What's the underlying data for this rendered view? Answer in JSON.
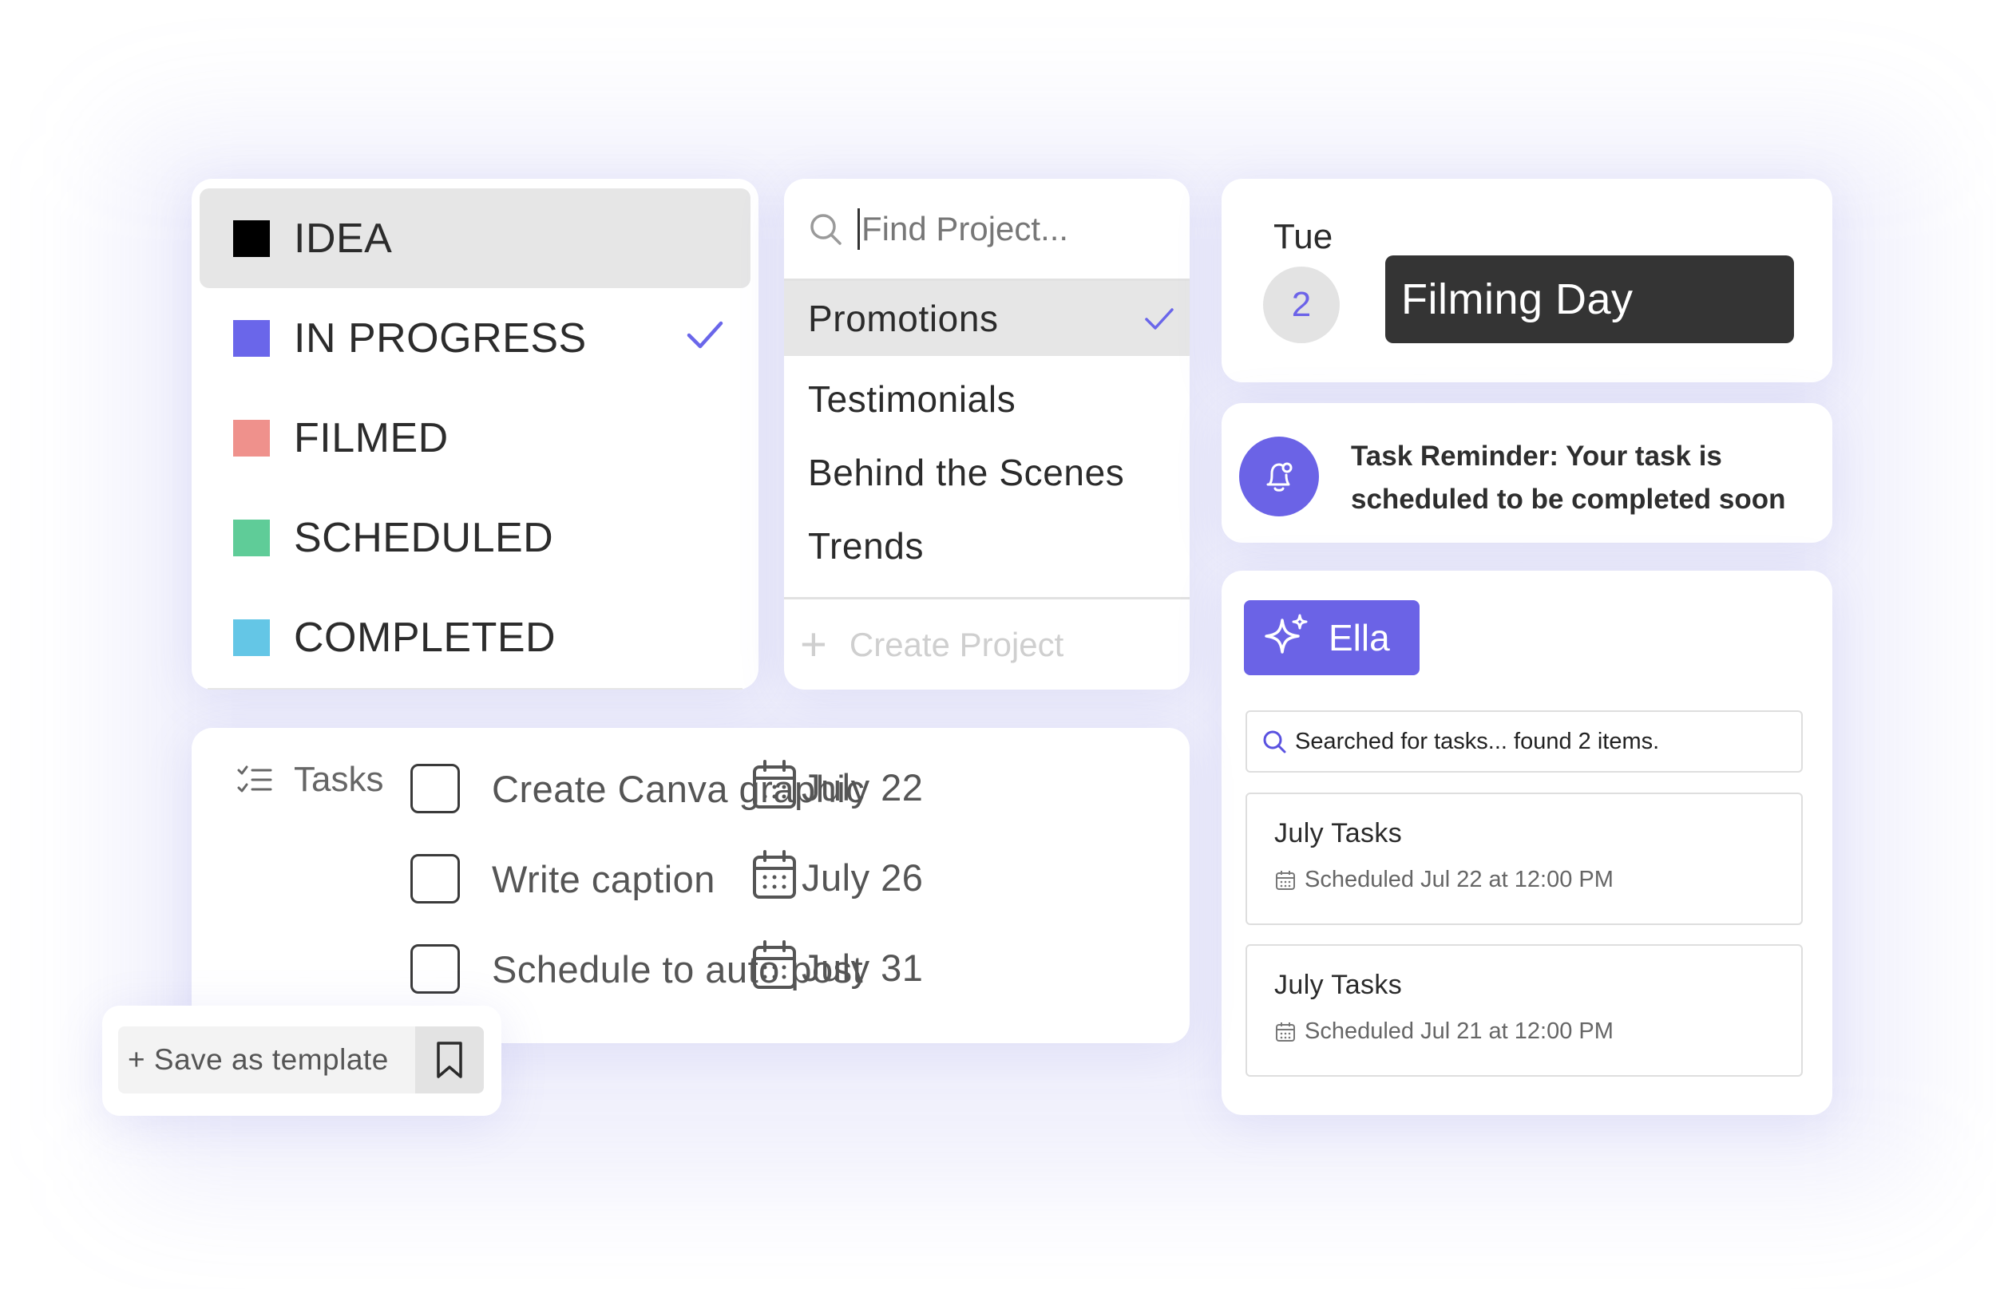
{
  "statuses": [
    {
      "label": "IDEA",
      "color": "#000000",
      "active": true
    },
    {
      "label": "IN PROGRESS",
      "color": "#6a66ea",
      "checked": true
    },
    {
      "label": "FILMED",
      "color": "#ef918c"
    },
    {
      "label": "SCHEDULED",
      "color": "#5fcc98"
    },
    {
      "label": "COMPLETED",
      "color": "#64c6e6"
    }
  ],
  "project_search": {
    "placeholder": "Find Project...",
    "items": [
      "Promotions",
      "Testimonials",
      "Behind the Scenes",
      "Trends"
    ],
    "selected": "Promotions",
    "create_label": "Create Project"
  },
  "calendar": {
    "day_name": "Tue",
    "day_number": "2",
    "event": "Filming Day"
  },
  "reminder": {
    "text": "Task Reminder: Your task is scheduled to be completed soon"
  },
  "assistant": {
    "name": "Ella",
    "search_status": "Searched for tasks... found 2 items.",
    "results": [
      {
        "title": "July Tasks",
        "scheduled": "Scheduled Jul 22 at 12:00 PM"
      },
      {
        "title": "July Tasks",
        "scheduled": "Scheduled Jul 21 at 12:00 PM"
      }
    ]
  },
  "tasks": {
    "label": "Tasks",
    "items": [
      {
        "name": "Create Canva graphic",
        "date": "July 22"
      },
      {
        "name": "Write caption",
        "date": "July 26"
      },
      {
        "name": "Schedule to auto post",
        "date": "July 31"
      }
    ]
  },
  "template": {
    "save_label": "+ Save as template"
  },
  "colors": {
    "accent": "#6b63e6",
    "dark_pill": "#343434",
    "active_row": "#e6e6e6"
  }
}
